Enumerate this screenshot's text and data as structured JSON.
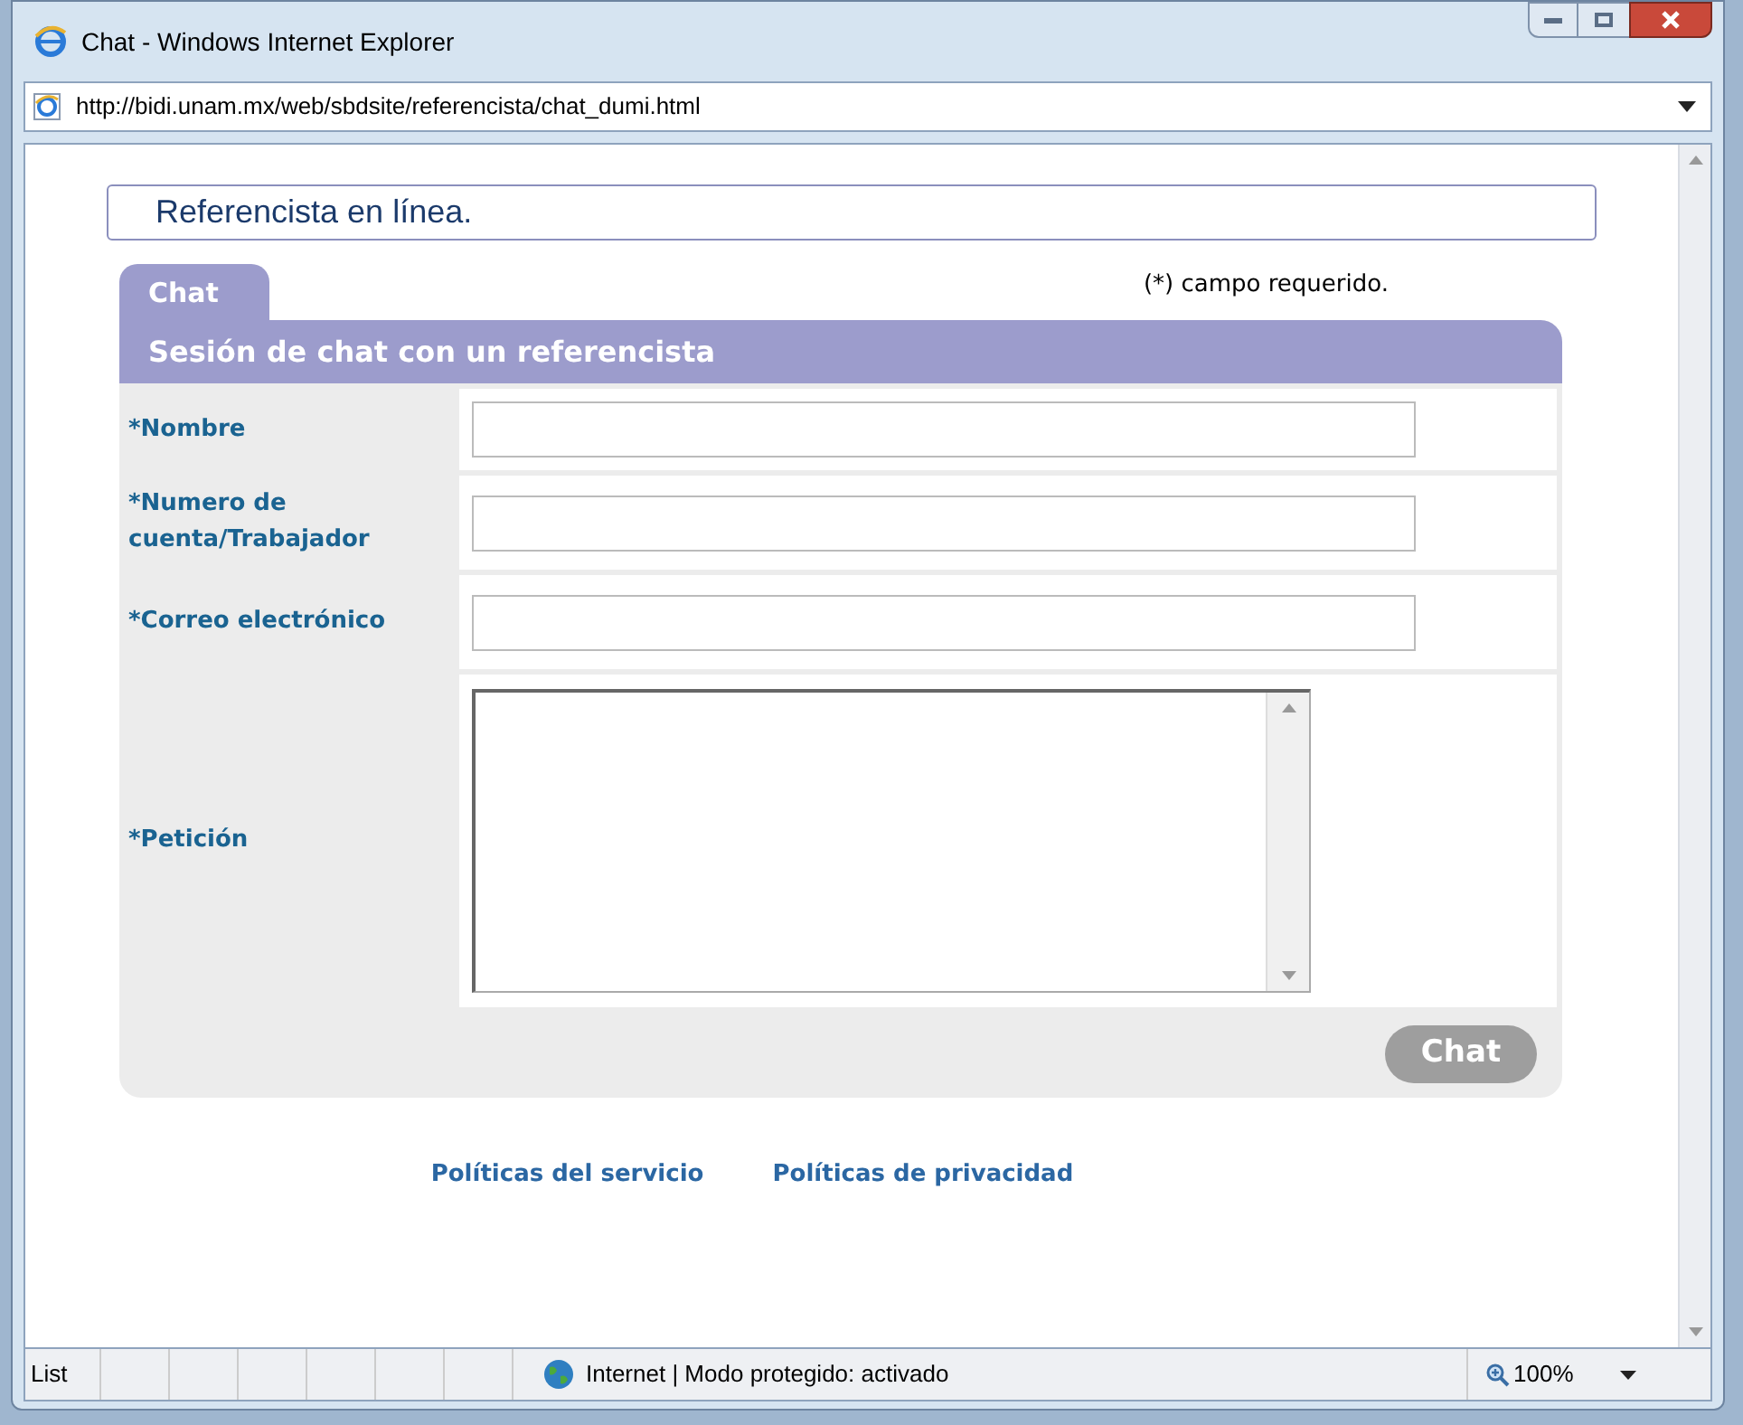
{
  "window": {
    "title": "Chat - Windows Internet Explorer"
  },
  "address_bar": {
    "url": "http://bidi.unam.mx/web/sbdsite/referencista/chat_dumi.html"
  },
  "page": {
    "heading": "Referencista en línea.",
    "tab": {
      "label": "Chat",
      "selected": true
    },
    "required_note": "(*) campo requerido.",
    "section_title": "Sesión de chat con un referencista",
    "fields": [
      {
        "kind": "input",
        "label": "*Nombre"
      },
      {
        "kind": "input",
        "label": "*Numero de cuenta/Trabajador"
      },
      {
        "kind": "input",
        "label": "*Correo electrónico"
      },
      {
        "kind": "textarea",
        "label": "*Petición"
      }
    ],
    "submit": "Chat",
    "links": [
      "Políticas del servicio",
      "Políticas de privacidad"
    ]
  },
  "status_bar": {
    "status": "List",
    "zone": "Internet | Modo protegido: activado",
    "zoom": "100%"
  }
}
